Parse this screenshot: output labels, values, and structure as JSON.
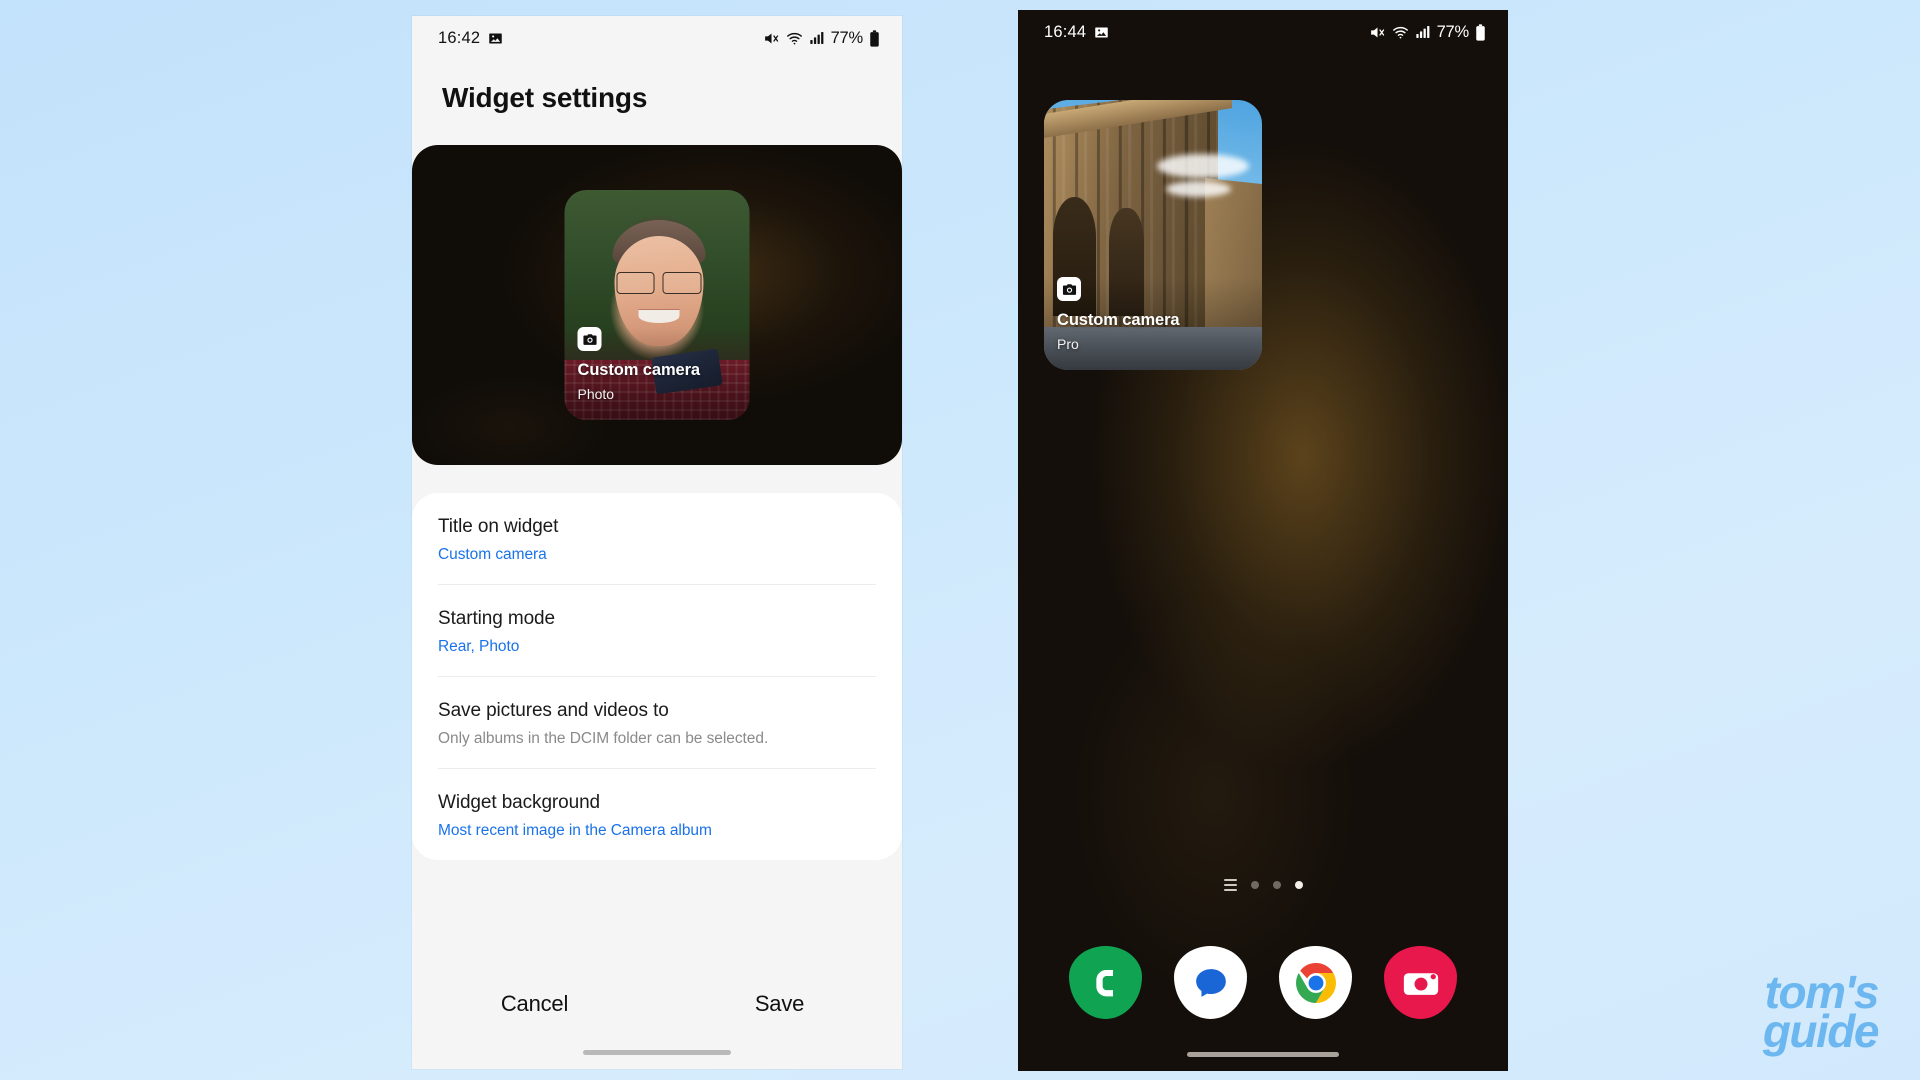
{
  "background": {
    "gradient_from": "#c3e2fb",
    "gradient_to": "#d6ecfd"
  },
  "watermark": {
    "line1": "tom's",
    "line2": "guide",
    "color": "#6cb7ef"
  },
  "left_phone": {
    "status_bar": {
      "time": "16:42",
      "battery_percent": "77%",
      "icons": [
        "image-icon",
        "mute-icon",
        "wifi-icon",
        "signal-icon",
        "battery-icon"
      ]
    },
    "page_title": "Widget settings",
    "preview": {
      "widget_title": "Custom camera",
      "widget_subtitle": "Photo",
      "icon": "camera-icon"
    },
    "settings": [
      {
        "label": "Title on widget",
        "value": "Custom camera",
        "value_style": "link"
      },
      {
        "label": "Starting mode",
        "value": "Rear, Photo",
        "value_style": "link"
      },
      {
        "label": "Save pictures and videos to",
        "value": "Only albums in the DCIM folder can be selected.",
        "value_style": "muted"
      },
      {
        "label": "Widget background",
        "value": "Most recent image in the Camera album",
        "value_style": "link"
      }
    ],
    "actions": {
      "cancel_label": "Cancel",
      "save_label": "Save"
    }
  },
  "right_phone": {
    "status_bar": {
      "time": "16:44",
      "battery_percent": "77%",
      "icons": [
        "image-icon",
        "mute-icon",
        "wifi-icon",
        "signal-icon",
        "battery-icon"
      ]
    },
    "home_widget": {
      "widget_title": "Custom camera",
      "widget_subtitle": "Pro",
      "icon": "camera-icon"
    },
    "page_indicator": {
      "total_dots": 3,
      "active_index": 2,
      "has_app_list_icon": true
    },
    "dock": [
      {
        "name": "phone-app-icon",
        "color": "#10a352"
      },
      {
        "name": "messages-app-icon",
        "color": "#ffffff"
      },
      {
        "name": "chrome-app-icon",
        "color": "#ffffff"
      },
      {
        "name": "camera-app-icon",
        "color": "#e8174c"
      }
    ]
  }
}
